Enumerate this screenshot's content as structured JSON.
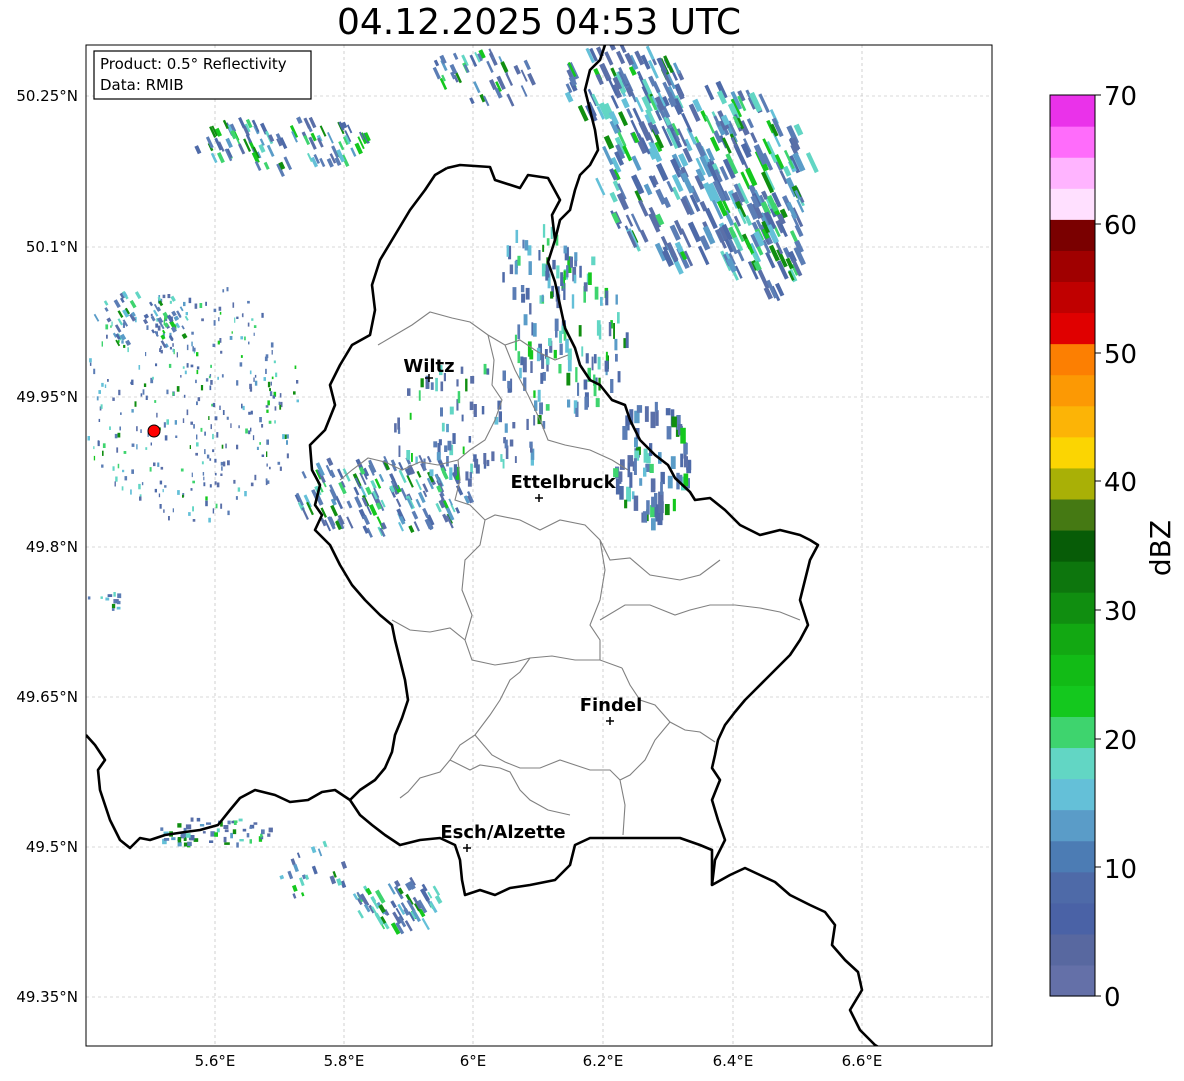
{
  "title": "04.12.2025 04:53 UTC",
  "info_box": {
    "line1": "Product: 0.5° Reflectivity",
    "line2": "Data: RMIB"
  },
  "lat_ticks": [
    "50.25°N",
    "50.1°N",
    "49.95°N",
    "49.8°N",
    "49.65°N",
    "49.5°N",
    "49.35°N"
  ],
  "lon_ticks": [
    "5.6°E",
    "5.8°E",
    "6°E",
    "6.2°E",
    "6.4°E",
    "6.6°E"
  ],
  "cities": [
    {
      "name": "Wiltz"
    },
    {
      "name": "Ettelbruck"
    },
    {
      "name": "Findel"
    },
    {
      "name": "Esch/Alzette"
    }
  ],
  "colorbar": {
    "label": "dBZ",
    "ticks": [
      "0",
      "10",
      "20",
      "30",
      "40",
      "50",
      "60",
      "70"
    ],
    "colors": [
      "#6470a8",
      "#5868a0",
      "#4a62a6",
      "#4e6aa8",
      "#4c7cb4",
      "#5a9cc8",
      "#64c0d8",
      "#62d6c4",
      "#3ed46e",
      "#14c81e",
      "#12bb16",
      "#12a812",
      "#108e10",
      "#0d760d",
      "#075c07",
      "#457913",
      "#a9b006",
      "#fbd502",
      "#fcb406",
      "#fc9904",
      "#fc7f02",
      "#e00000",
      "#c00000",
      "#a00000",
      "#7a0000",
      "#ffe0ff",
      "#ffb4ff",
      "#ff6cfb",
      "#ea32ea"
    ]
  },
  "radar_site": {
    "color": "#ff0000"
  }
}
